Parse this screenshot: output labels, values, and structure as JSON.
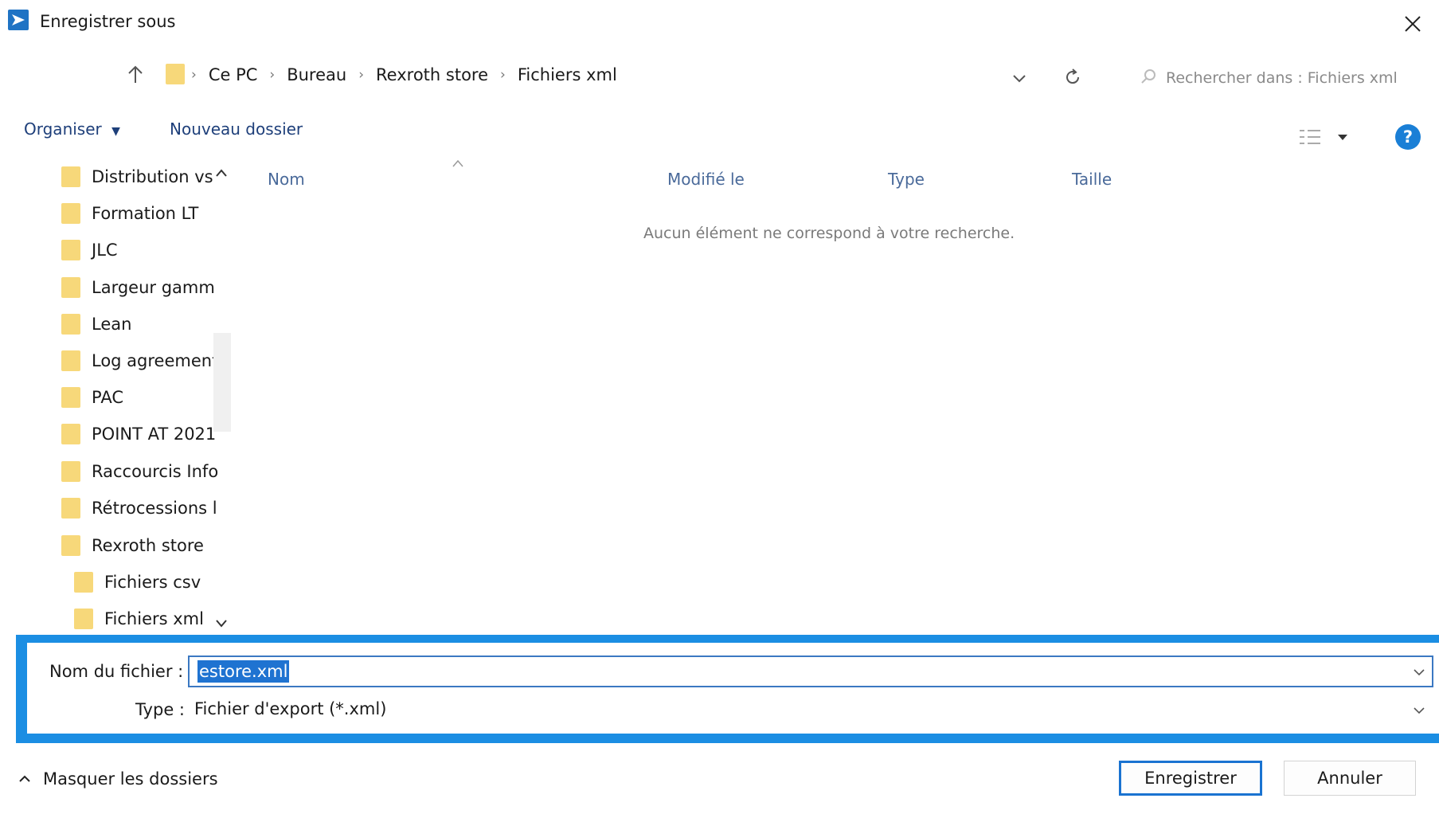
{
  "window": {
    "title": "Enregistrer sous"
  },
  "address": {
    "breadcrumbs": [
      "Ce PC",
      "Bureau",
      "Rexroth store",
      "Fichiers xml"
    ]
  },
  "search": {
    "placeholder": "Rechercher dans : Fichiers xml"
  },
  "toolbar": {
    "organize_label": "Organiser",
    "new_folder_label": "Nouveau dossier",
    "help_label": "?"
  },
  "sidebar": {
    "items": [
      {
        "label": "Distribution vs"
      },
      {
        "label": "Formation LT"
      },
      {
        "label": "JLC"
      },
      {
        "label": "Largeur gamm"
      },
      {
        "label": "Lean"
      },
      {
        "label": "Log agreement"
      },
      {
        "label": "PAC"
      },
      {
        "label": "POINT AT 2021"
      },
      {
        "label": "Raccourcis Info"
      },
      {
        "label": "Rétrocessions l"
      },
      {
        "label": "Rexroth store"
      },
      {
        "label": "Fichiers csv"
      },
      {
        "label": "Fichiers xml"
      }
    ]
  },
  "columns": {
    "name": "Nom",
    "modified": "Modifié le",
    "type": "Type",
    "size": "Taille"
  },
  "empty_message": "Aucun élément ne correspond à votre recherche.",
  "form": {
    "filename_label": "Nom du fichier :",
    "filename_value": "estore.xml",
    "type_label": "Type :",
    "type_value": "Fichier d'export (*.xml)"
  },
  "footer": {
    "toggle_folders_label": "Masquer les dossiers",
    "save_label": "Enregistrer",
    "cancel_label": "Annuler"
  },
  "colors": {
    "accent": "#1b8ee3",
    "folder": "#f7d87a",
    "link_text": "#1e3f7a"
  }
}
